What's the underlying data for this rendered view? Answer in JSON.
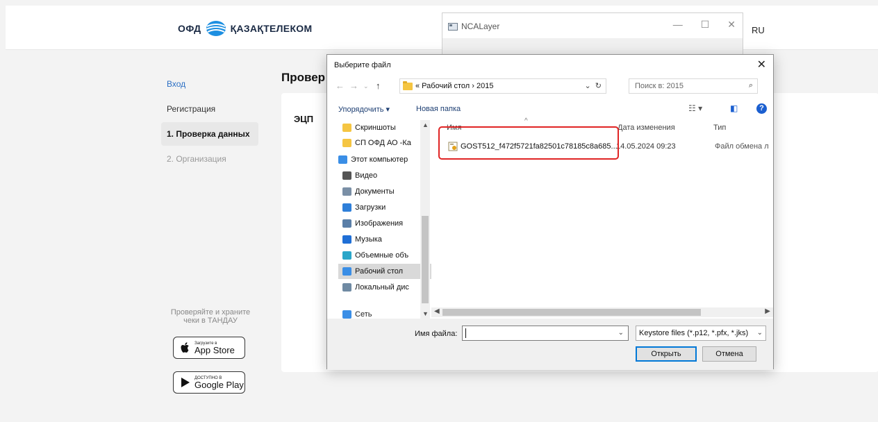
{
  "site": {
    "logo_ofd": "ОФД",
    "logo_kt": "ҚАЗАҚТЕЛЕКОМ",
    "lang": "RU",
    "nav": [
      "Вход",
      "Регистрация",
      "1. Проверка данных",
      "2. Организация"
    ],
    "page_title": "Провер",
    "card_label": "ЭЦП",
    "promo_line1": "Проверяйте и храните",
    "promo_line2": "чеки в ТАНДАУ",
    "appstore_small": "Загрузите в",
    "appstore_big": "App Store",
    "gplay_small": "ДОСТУПНО В",
    "gplay_big": "Google Play"
  },
  "nca": {
    "title": "NCALayer"
  },
  "dialog": {
    "title": "Выберите файл",
    "address": "« Рабочий стол › 2015",
    "search_placeholder": "Поиск в: 2015",
    "toolbar": {
      "organize": "Упорядочить ▾",
      "new_folder": "Новая папка"
    },
    "tree": [
      {
        "label": "Скриншоты",
        "color": "#f5c542"
      },
      {
        "label": "СП ОФД АО -Ка",
        "color": "#f5c542"
      },
      {
        "label": "Этот компьютер",
        "color": "#3a8ee6"
      },
      {
        "label": "Видео",
        "color": "#555555"
      },
      {
        "label": "Документы",
        "color": "#7a8fa6"
      },
      {
        "label": "Загрузки",
        "color": "#2e7fd9"
      },
      {
        "label": "Изображения",
        "color": "#5a7fa8"
      },
      {
        "label": "Музыка",
        "color": "#1f6fd6"
      },
      {
        "label": "Объемные объ",
        "color": "#2aa6c9"
      },
      {
        "label": "Рабочий стол",
        "color": "#3a8ee6"
      },
      {
        "label": "Локальный дис",
        "color": "#6f8aa3"
      }
    ],
    "network": "Сеть",
    "columns": {
      "name": "Имя",
      "date": "Дата изменения",
      "type": "Тип"
    },
    "files": [
      {
        "name": "GOST512_f472f5721fa82501c78185c8a685...",
        "date": "14.05.2024 09:23",
        "type": "Файл обмена л"
      }
    ],
    "filename_label": "Имя файла:",
    "filename_value": "",
    "filter": "Keystore files (*.p12, *.pfx, *.jks)",
    "open_button": "Открыть",
    "cancel_button": "Отмена"
  }
}
